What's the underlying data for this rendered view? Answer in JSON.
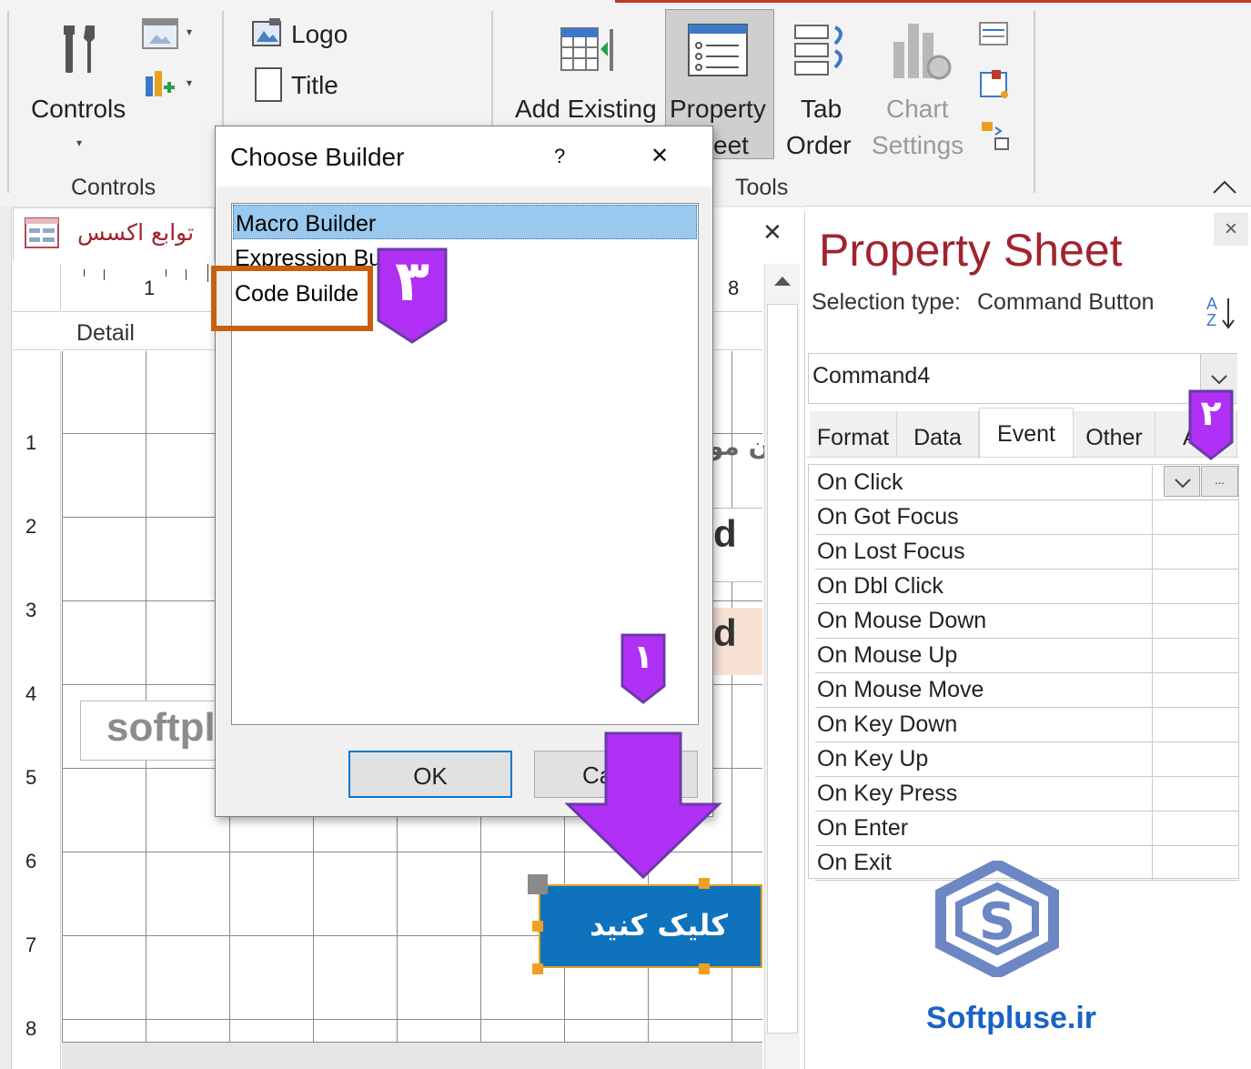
{
  "ribbon": {
    "controls_label": "Controls",
    "controls_group": "Controls",
    "logo_label": "Logo",
    "title_label": "Title",
    "add_existing_label": "Add Existing",
    "property_label_1": "Property",
    "property_label_2": "eet",
    "tab_order_1": "Tab",
    "tab_order_2": "Order",
    "chart_1": "Chart",
    "chart_2": "Settings",
    "tools_group": "Tools"
  },
  "document": {
    "tab_title": "توابع اکسس",
    "section_label": "Detail",
    "ruler_h": [
      "1",
      "8"
    ],
    "ruler_v": [
      "1",
      "2",
      "3",
      "4",
      "5",
      "6",
      "7",
      "8"
    ],
    "partial_label_1": "ن مو",
    "partial_text_2": "d",
    "partial_text_3": "d",
    "watermark_text": "softpl",
    "button_caption": "کلیک کنید",
    "close_glyph": "✕"
  },
  "property_sheet": {
    "title": "Property Sheet",
    "selection_type_label": "Selection type:",
    "selection_type_value": "Command Button",
    "object_name": "Command4",
    "tabs": [
      "Format",
      "Data",
      "Event",
      "Other",
      "A"
    ],
    "active_tab": "Event",
    "events": [
      "On Click",
      "On Got Focus",
      "On Lost Focus",
      "On Dbl Click",
      "On Mouse Down",
      "On Mouse Up",
      "On Mouse Move",
      "On Key Down",
      "On Key Up",
      "On Key Press",
      "On Enter",
      "On Exit"
    ],
    "builder_btn": "...",
    "close_glyph": "×",
    "sort_glyph_a": "A",
    "sort_glyph_z": "Z"
  },
  "dialog": {
    "title": "Choose Builder",
    "help_glyph": "?",
    "close_glyph": "✕",
    "items": [
      "Macro Builder",
      "Expression Bu",
      "Code Builde"
    ],
    "selected_index": 0,
    "ok_label": "OK",
    "cancel_label": "Ca"
  },
  "annotations": {
    "badge_1": "۱",
    "badge_2": "۲",
    "badge_3": "۳",
    "accent_purple": "#b130f5",
    "highlight_orange": "#c8600f"
  },
  "brand": {
    "site": "Softpluse.ir",
    "color": "#1a63c4"
  }
}
